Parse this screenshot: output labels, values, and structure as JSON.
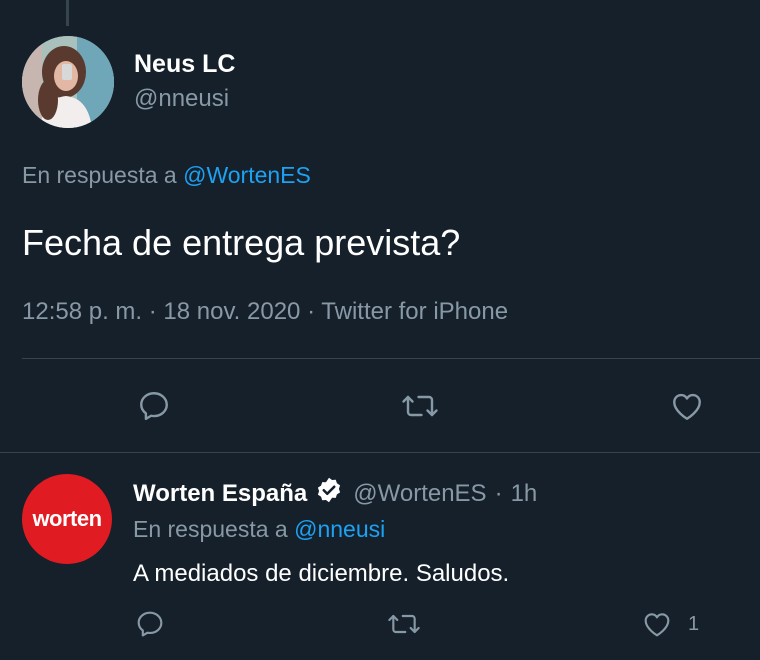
{
  "main_tweet": {
    "author_name": "Neus LC",
    "author_handle": "@nneusi",
    "reply_prefix": "En respuesta a",
    "reply_mention": "@WortenES",
    "text": "Fecha de entrega prevista?",
    "meta": "12:58 p. m. · 18 nov. 2020 · Twitter for iPhone"
  },
  "reply_tweet": {
    "avatar_text": "worten",
    "author_name": "Worten España",
    "author_handle": "@WortenES",
    "separator": "·",
    "time": "1h",
    "reply_prefix": "En respuesta a",
    "reply_mention": "@nneusi",
    "text": "A mediados de diciembre. Saludos.",
    "like_count": "1"
  },
  "colors": {
    "background": "#15202b",
    "secondary_text": "#8899a6",
    "link": "#1da1f2",
    "divider": "#38444d",
    "worten_red": "#e11b22"
  },
  "icons": [
    "reply-icon",
    "retweet-icon",
    "like-icon",
    "verified-badge-icon"
  ]
}
